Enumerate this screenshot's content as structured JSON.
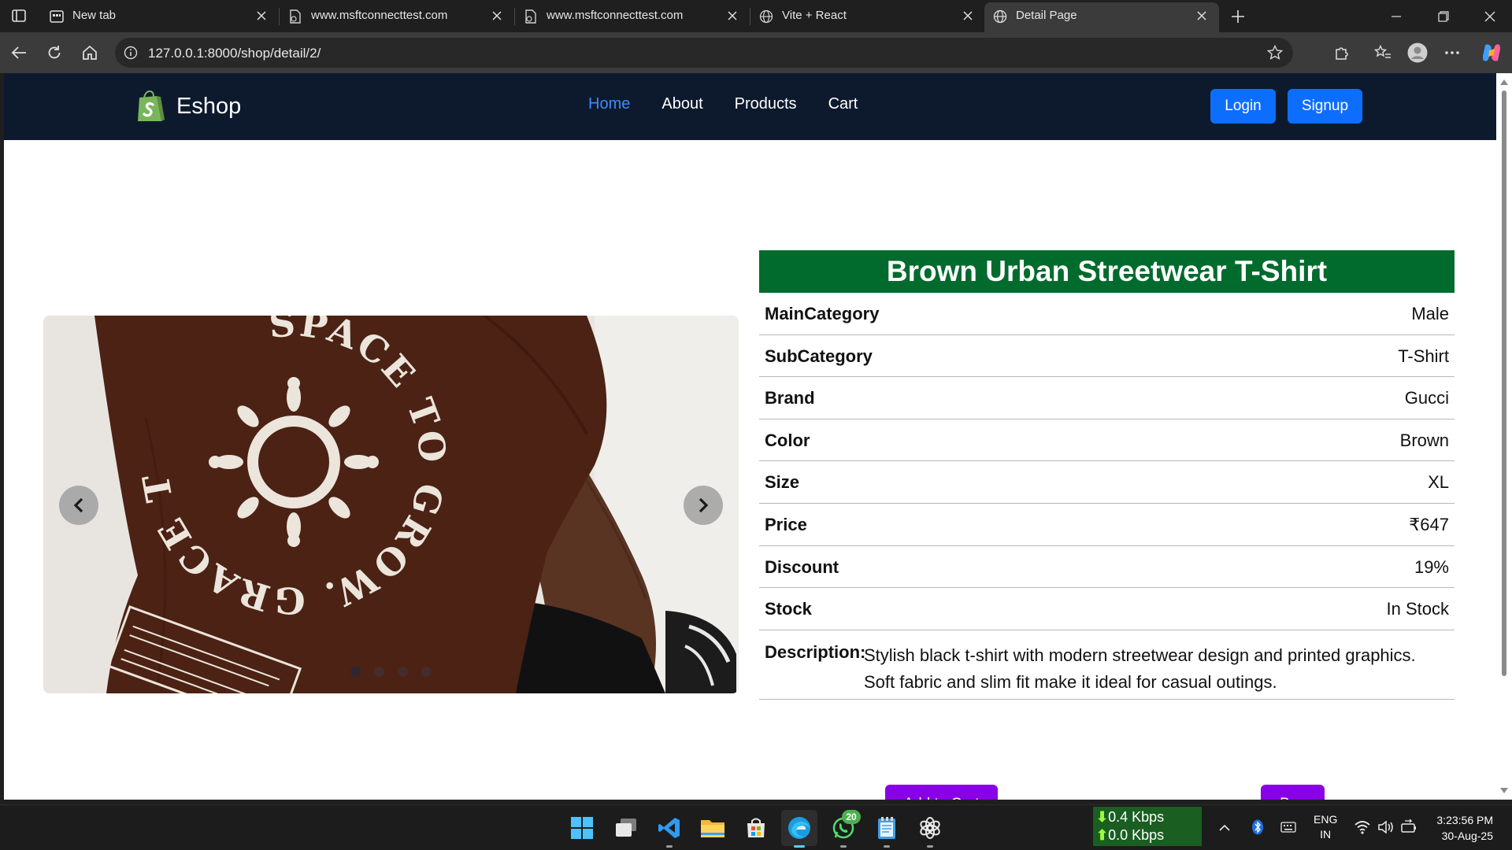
{
  "browser": {
    "tabs": [
      {
        "title": "New tab",
        "icon": "new-tab-page-icon"
      },
      {
        "title": "www.msftconnecttest.com",
        "icon": "document-icon"
      },
      {
        "title": "www.msftconnecttest.com",
        "icon": "document-icon"
      },
      {
        "title": "Vite + React",
        "icon": "globe-icon"
      },
      {
        "title": "Detail Page",
        "icon": "globe-icon"
      }
    ],
    "url": "127.0.0.1:8000/shop/detail/2/"
  },
  "site": {
    "brand": "Eshop",
    "nav": [
      {
        "label": "Home",
        "active": true
      },
      {
        "label": "About",
        "active": false
      },
      {
        "label": "Products",
        "active": false
      },
      {
        "label": "Cart",
        "active": false
      }
    ],
    "login_label": "Login",
    "signup_label": "Signup"
  },
  "product": {
    "title": "Brown Urban Streetwear T-Shirt",
    "image_print_text": "SPACE TO GROW. GRACE TO LEARN.",
    "specs": [
      {
        "key": "MainCategory",
        "value": "Male"
      },
      {
        "key": "SubCategory",
        "value": "T-Shirt"
      },
      {
        "key": "Brand",
        "value": "Gucci"
      },
      {
        "key": "Color",
        "value": "Brown"
      },
      {
        "key": "Size",
        "value": "XL"
      },
      {
        "key": "Price",
        "value": "₹647"
      },
      {
        "key": "Discount",
        "value": "19%"
      },
      {
        "key": "Stock",
        "value": "In Stock"
      }
    ],
    "description_label": "Description:",
    "description": "Stylish black t-shirt with modern streetwear design and printed graphics. Soft fabric and slim fit make it ideal for casual outings.",
    "add_to_cart_label": "Add to Cart",
    "buy_label": "Buy",
    "carousel_slides": 4,
    "carousel_active": 1
  },
  "taskbar": {
    "whatsapp_badge": "20",
    "net_down": "0.4 Kbps",
    "net_up": "0.0 Kbps",
    "lang_line1": "ENG",
    "lang_line2": "IN",
    "time": "3:23:56 PM",
    "date": "30-Aug-25"
  },
  "colors": {
    "navbar": "#0d1a2e",
    "title_bar": "#006b2d",
    "primary_button": "#0d6efd",
    "purchase_button": "#8a00e6",
    "nav_active": "#3d8bfd"
  }
}
